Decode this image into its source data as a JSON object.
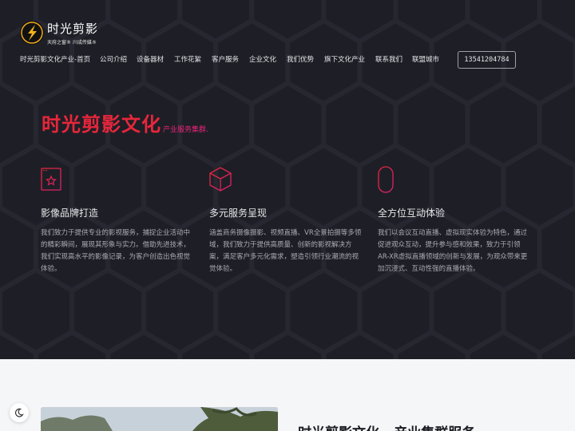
{
  "brand": {
    "title": "时光剪影",
    "subtitle": "天府之窗® 川成传媒®"
  },
  "nav": {
    "items": [
      "时光剪影文化产业-首页",
      "公司介绍",
      "设备器材",
      "工作花絮",
      "客户服务",
      "企业文化",
      "我们优势",
      "旗下文化产业",
      "联系我们",
      "联盟城市"
    ],
    "phone": "13541204784"
  },
  "hero": {
    "headline": "时光剪影文化",
    "headline_sub": "产业服务集群.",
    "colors": {
      "headline": "#e8263b",
      "accent_pink": "#e8237a",
      "background": "#1e1f26"
    }
  },
  "features": [
    {
      "icon": "star-window-icon",
      "title": "影像品牌打造",
      "desc": "我们致力于提供专业的影视服务，捕捉企业活动中的精彩瞬间，展现其形象与实力。借助先进技术，我们实现高水平的影像记录，为客户创造出色视觉体验。"
    },
    {
      "icon": "cube-icon",
      "title": "多元服务呈现",
      "desc": "涵盖商务摄像摄影、视频直播、VR全景拍摄等多领域，我们致力于提供高质量、创新的影视解决方案，满足客户多元化需求，塑造引领行业潮流的视觉体验。"
    },
    {
      "icon": "mouse-icon",
      "title": "全方位互动体验",
      "desc": "我们以会议互动直播、虚拟现实体验为特色，通过促进观众互动，提升参与感和效果，致力于引领AR-XR虚拟直播领域的创新与发展，为观众带来更加沉浸式、互动性强的直播体验。"
    }
  ],
  "lower": {
    "title": "时光剪影文化 · 产业集群服务"
  }
}
